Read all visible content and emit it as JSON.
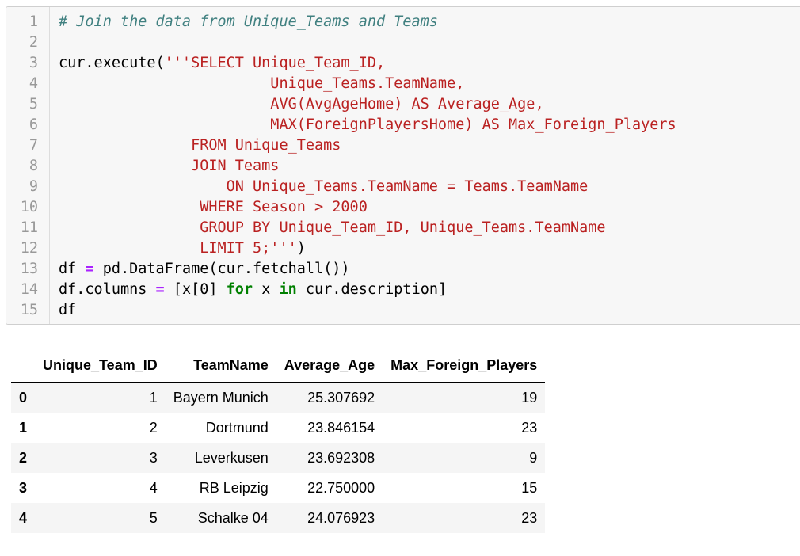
{
  "code_cell": {
    "lines": [
      {
        "num": "1",
        "segments": [
          {
            "cls": "cm",
            "text": "# Join the data from Unique_Teams and Teams"
          }
        ]
      },
      {
        "num": "2",
        "segments": []
      },
      {
        "num": "3",
        "segments": [
          {
            "cls": "plain",
            "text": "cur.execute("
          },
          {
            "cls": "str",
            "text": "'''SELECT Unique_Team_ID,"
          }
        ]
      },
      {
        "num": "4",
        "segments": [
          {
            "cls": "str",
            "text": "                        Unique_Teams.TeamName,"
          }
        ]
      },
      {
        "num": "5",
        "segments": [
          {
            "cls": "str",
            "text": "                        AVG(AvgAgeHome) AS Average_Age,"
          }
        ]
      },
      {
        "num": "6",
        "segments": [
          {
            "cls": "str",
            "text": "                        MAX(ForeignPlayersHome) AS Max_Foreign_Players"
          }
        ]
      },
      {
        "num": "7",
        "segments": [
          {
            "cls": "str",
            "text": "               FROM Unique_Teams"
          }
        ]
      },
      {
        "num": "8",
        "segments": [
          {
            "cls": "str",
            "text": "               JOIN Teams"
          }
        ]
      },
      {
        "num": "9",
        "segments": [
          {
            "cls": "str",
            "text": "                   ON Unique_Teams.TeamName = Teams.TeamName"
          }
        ]
      },
      {
        "num": "10",
        "segments": [
          {
            "cls": "str",
            "text": "                WHERE Season > 2000"
          }
        ]
      },
      {
        "num": "11",
        "segments": [
          {
            "cls": "str",
            "text": "                GROUP BY Unique_Team_ID, Unique_Teams.TeamName"
          }
        ]
      },
      {
        "num": "12",
        "segments": [
          {
            "cls": "str",
            "text": "                LIMIT 5;'''"
          },
          {
            "cls": "plain",
            "text": ")"
          }
        ]
      },
      {
        "num": "13",
        "segments": [
          {
            "cls": "plain",
            "text": "df "
          },
          {
            "cls": "op",
            "text": "="
          },
          {
            "cls": "plain",
            "text": " pd.DataFrame(cur.fetchall())"
          }
        ]
      },
      {
        "num": "14",
        "segments": [
          {
            "cls": "plain",
            "text": "df.columns "
          },
          {
            "cls": "op",
            "text": "="
          },
          {
            "cls": "plain",
            "text": " [x["
          },
          {
            "cls": "plain",
            "text": "0"
          },
          {
            "cls": "plain",
            "text": "] "
          },
          {
            "cls": "kw",
            "text": "for"
          },
          {
            "cls": "plain",
            "text": " x "
          },
          {
            "cls": "kw",
            "text": "in"
          },
          {
            "cls": "plain",
            "text": " cur.description]"
          }
        ]
      },
      {
        "num": "15",
        "segments": [
          {
            "cls": "plain",
            "text": "df"
          }
        ]
      }
    ]
  },
  "output_table": {
    "columns": [
      "",
      "Unique_Team_ID",
      "TeamName",
      "Average_Age",
      "Max_Foreign_Players"
    ],
    "rows": [
      {
        "index": "0",
        "cells": [
          "1",
          "Bayern Munich",
          "25.307692",
          "19"
        ]
      },
      {
        "index": "1",
        "cells": [
          "2",
          "Dortmund",
          "23.846154",
          "23"
        ]
      },
      {
        "index": "2",
        "cells": [
          "3",
          "Leverkusen",
          "23.692308",
          "9"
        ]
      },
      {
        "index": "3",
        "cells": [
          "4",
          "RB Leipzig",
          "22.750000",
          "15"
        ]
      },
      {
        "index": "4",
        "cells": [
          "5",
          "Schalke 04",
          "24.076923",
          "23"
        ]
      }
    ]
  }
}
